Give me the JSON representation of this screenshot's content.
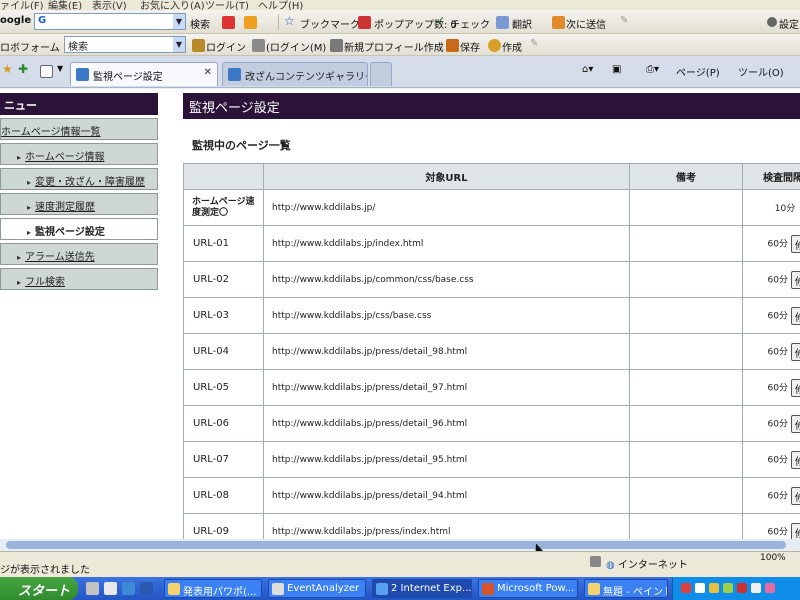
{
  "menubar": {
    "items": [
      "ァイル(F)",
      "編集(E)",
      "表示(V)",
      "お気に入り(A)",
      "ツール(T)",
      "ヘルプ(H)"
    ]
  },
  "toolbar1": {
    "google_label": "oogle",
    "search_label": "検索",
    "bookmark_label": "ブックマーク",
    "popup_label": "ポップアップ数: 0",
    "check_label": "チェック",
    "translate_label": "翻訳",
    "next_label": "次に送信",
    "settings_label": "設定"
  },
  "toolbar2": {
    "roboform_label": "ロボフォーム",
    "search_value": "検索",
    "login_label": "ログイン",
    "login_m_label": "(ログイン(M)",
    "new_profile_label": "新規プロフィール作成",
    "save_label": "保存",
    "create_label": "作成"
  },
  "tabs": [
    {
      "label": "監視ページ設定",
      "active": true
    },
    {
      "label": "改ざんコンテンツギャラリー ～ ...",
      "active": false
    }
  ],
  "right_tools": {
    "page_label": "ページ(P)",
    "tools_label": "ツール(O)"
  },
  "sidebar": {
    "header": "ニュー",
    "items": [
      {
        "label": "ホームページ情報一覧",
        "level": 0,
        "current": false
      },
      {
        "label": "ホームページ情報",
        "level": 1,
        "current": false
      },
      {
        "label": "変更・改ざん・障害履歴",
        "level": 2,
        "current": false
      },
      {
        "label": "速度測定履歴",
        "level": 2,
        "current": false
      },
      {
        "label": "監視ページ設定",
        "level": 2,
        "current": true
      },
      {
        "label": "アラーム送信先",
        "level": 1,
        "current": false
      },
      {
        "label": "フル検索",
        "level": 1,
        "current": false
      }
    ]
  },
  "main": {
    "title": "監視ページ設定",
    "section_title": "監視中のページ一覧",
    "columns": [
      "",
      "対象URL",
      "備考",
      "検査間隔"
    ],
    "rows": [
      {
        "id": "ホームページ速度測定〇",
        "url": "http://www.kddilabs.jp/",
        "note": "",
        "interval": "10分",
        "has_fix": false
      },
      {
        "id": "URL-01",
        "url": "http://www.kddilabs.jp/index.html",
        "note": "",
        "interval": "60分",
        "has_fix": true
      },
      {
        "id": "URL-02",
        "url": "http://www.kddilabs.jp/common/css/base.css",
        "note": "",
        "interval": "60分",
        "has_fix": true
      },
      {
        "id": "URL-03",
        "url": "http://www.kddilabs.jp/css/base.css",
        "note": "",
        "interval": "60分",
        "has_fix": true
      },
      {
        "id": "URL-04",
        "url": "http://www.kddilabs.jp/press/detail_98.html",
        "note": "",
        "interval": "60分",
        "has_fix": true
      },
      {
        "id": "URL-05",
        "url": "http://www.kddilabs.jp/press/detail_97.html",
        "note": "",
        "interval": "60分",
        "has_fix": true
      },
      {
        "id": "URL-06",
        "url": "http://www.kddilabs.jp/press/detail_96.html",
        "note": "",
        "interval": "60分",
        "has_fix": true
      },
      {
        "id": "URL-07",
        "url": "http://www.kddilabs.jp/press/detail_95.html",
        "note": "",
        "interval": "60分",
        "has_fix": true
      },
      {
        "id": "URL-08",
        "url": "http://www.kddilabs.jp/press/detail_94.html",
        "note": "",
        "interval": "60分",
        "has_fix": true
      },
      {
        "id": "URL-09",
        "url": "http://www.kddilabs.jp/press/index.html",
        "note": "",
        "interval": "60分",
        "has_fix": true
      }
    ],
    "fix_label": "修正"
  },
  "status": {
    "text": "ジが表示されました",
    "zone": "インターネット",
    "zoom": "100%"
  },
  "taskbar": {
    "start_label": "スタート",
    "tasks": [
      {
        "label": "発表用パワポ(...",
        "active": false
      },
      {
        "label": "EventAnalyzer",
        "active": false
      },
      {
        "label": "2 Internet Exp...",
        "active": true
      },
      {
        "label": "Microsoft Pow...",
        "active": false
      },
      {
        "label": "無題 - ペイント",
        "active": false
      }
    ]
  },
  "colors": {
    "header_bg": "#2a1238",
    "sidebar_bg": "#cfd7d4",
    "table_header_bg": "#dfe4e7",
    "taskbar_bg": "#2455c3",
    "start_bg": "#2f8b2d"
  }
}
